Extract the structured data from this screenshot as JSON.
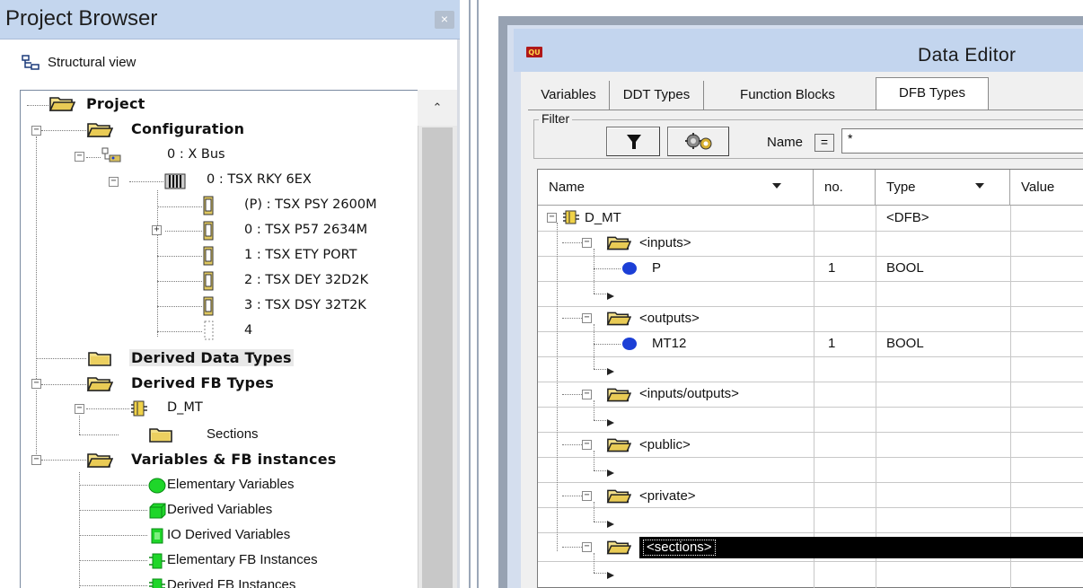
{
  "project_browser": {
    "title": "Project Browser",
    "close_label": "×",
    "view_label": "Structural view",
    "tree": {
      "project": "Project",
      "configuration": "Configuration",
      "xbus": "0 : X Bus",
      "rack": "0 : TSX RKY 6EX",
      "slot_p": "(P) : TSX PSY 2600M",
      "slot_0": "0 : TSX P57 2634M",
      "slot_1": "1 : TSX ETY PORT",
      "slot_2": "2 : TSX DEY 32D2K",
      "slot_3": "3 : TSX DSY 32T2K",
      "slot_4": "4",
      "derived_data_types": "Derived Data Types",
      "derived_fb_types": "Derived FB Types",
      "d_mt": "D_MT",
      "sections": "Sections",
      "vars_fb": "Variables & FB instances",
      "elem_vars": "Elementary Variables",
      "derived_vars": "Derived Variables",
      "io_derived_vars": "IO Derived Variables",
      "elem_fb": "Elementary FB Instances",
      "derived_fb": "Derived FB Instances"
    }
  },
  "data_editor": {
    "title": "Data Editor",
    "tabs": [
      "Variables",
      "DDT Types",
      "Function Blocks",
      "DFB Types"
    ],
    "active_tab": "DFB Types",
    "filter": {
      "label": "Filter",
      "name_label": "Name",
      "eq_label": "=",
      "name_value": "*"
    },
    "columns": [
      "Name",
      "no.",
      "Type",
      "Value"
    ],
    "rows": {
      "dfb": {
        "name": "D_MT",
        "no": "",
        "type": "<DFB>"
      },
      "inputs": {
        "name": "<inputs>"
      },
      "p": {
        "name": "P",
        "no": "1",
        "type": "BOOL"
      },
      "outputs": {
        "name": "<outputs>"
      },
      "mt12": {
        "name": "MT12",
        "no": "1",
        "type": "BOOL"
      },
      "inouts": {
        "name": "<inputs/outputs>"
      },
      "public": {
        "name": "<public>"
      },
      "private": {
        "name": "<private>"
      },
      "sections": {
        "name": "<sections>"
      }
    }
  },
  "colors": {
    "titlebar": "#c4d6ee",
    "selection": "#000000",
    "var_dot": "#1c3fd6",
    "folder": "#f0dc6e"
  }
}
